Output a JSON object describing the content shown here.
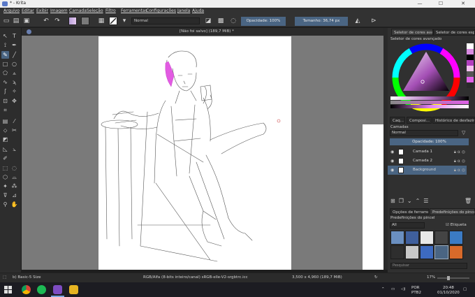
{
  "window": {
    "title": "* - Krita",
    "controls": {
      "minimize": "—",
      "maximize": "☐",
      "close": "✕"
    }
  },
  "menu": [
    "Arquivo",
    "Editar",
    "Exibir",
    "Imagem",
    "Camada",
    "Seleção",
    "Filtro",
    "Ferramentas",
    "Configurações",
    "Janela",
    "Ajuda"
  ],
  "toolbar": {
    "blend_mode": "Normal",
    "opacity_label": "Opacidade: 100%",
    "size_label": "Tamanho: 36,74 px"
  },
  "document": {
    "tab_title": "[Não foi salvo]  (189,7 MiB) *"
  },
  "docker": {
    "color_tabs": [
      "Seletor de cores avan...",
      "Seletor de cores espe..."
    ],
    "color_panel_title": "Seletor de cores avançado",
    "layer_tabs": [
      "Caq...",
      "Composi...",
      "Histórico de desfazime..."
    ],
    "layers_title": "Camadas",
    "layer_blend": "Normal",
    "layer_opacity": "Opacidade:  100%",
    "layers": [
      {
        "name": "Camada 1",
        "selected": false
      },
      {
        "name": "Camada 2",
        "selected": false
      },
      {
        "name": "Background",
        "selected": true
      }
    ],
    "preset_tabs": [
      "Opções de ferramenta",
      "Predefinições do pincel"
    ],
    "preset_title": "Predefinições do pincel",
    "preset_filter": "All",
    "preset_tag": "Etiqueta",
    "search_placeholder": "Pesquisar"
  },
  "statusbar": {
    "brush": "b) Basic-5 Size",
    "color_space": "RGB/Alfa (8-bits inteiro/canal)  sRGB-elle-V2-srgbtrc.icc",
    "dimensions": "3,500 x 4,960 (189,7 MiB)",
    "zoom": "17%"
  },
  "taskbar": {
    "language": "POR",
    "layout": "PTB2",
    "time": "20:48",
    "date": "01/10/2020"
  },
  "colors": {
    "accent": "#4a6583",
    "canvas_bg": "#7a7a7a",
    "panel_bg": "#303030"
  }
}
